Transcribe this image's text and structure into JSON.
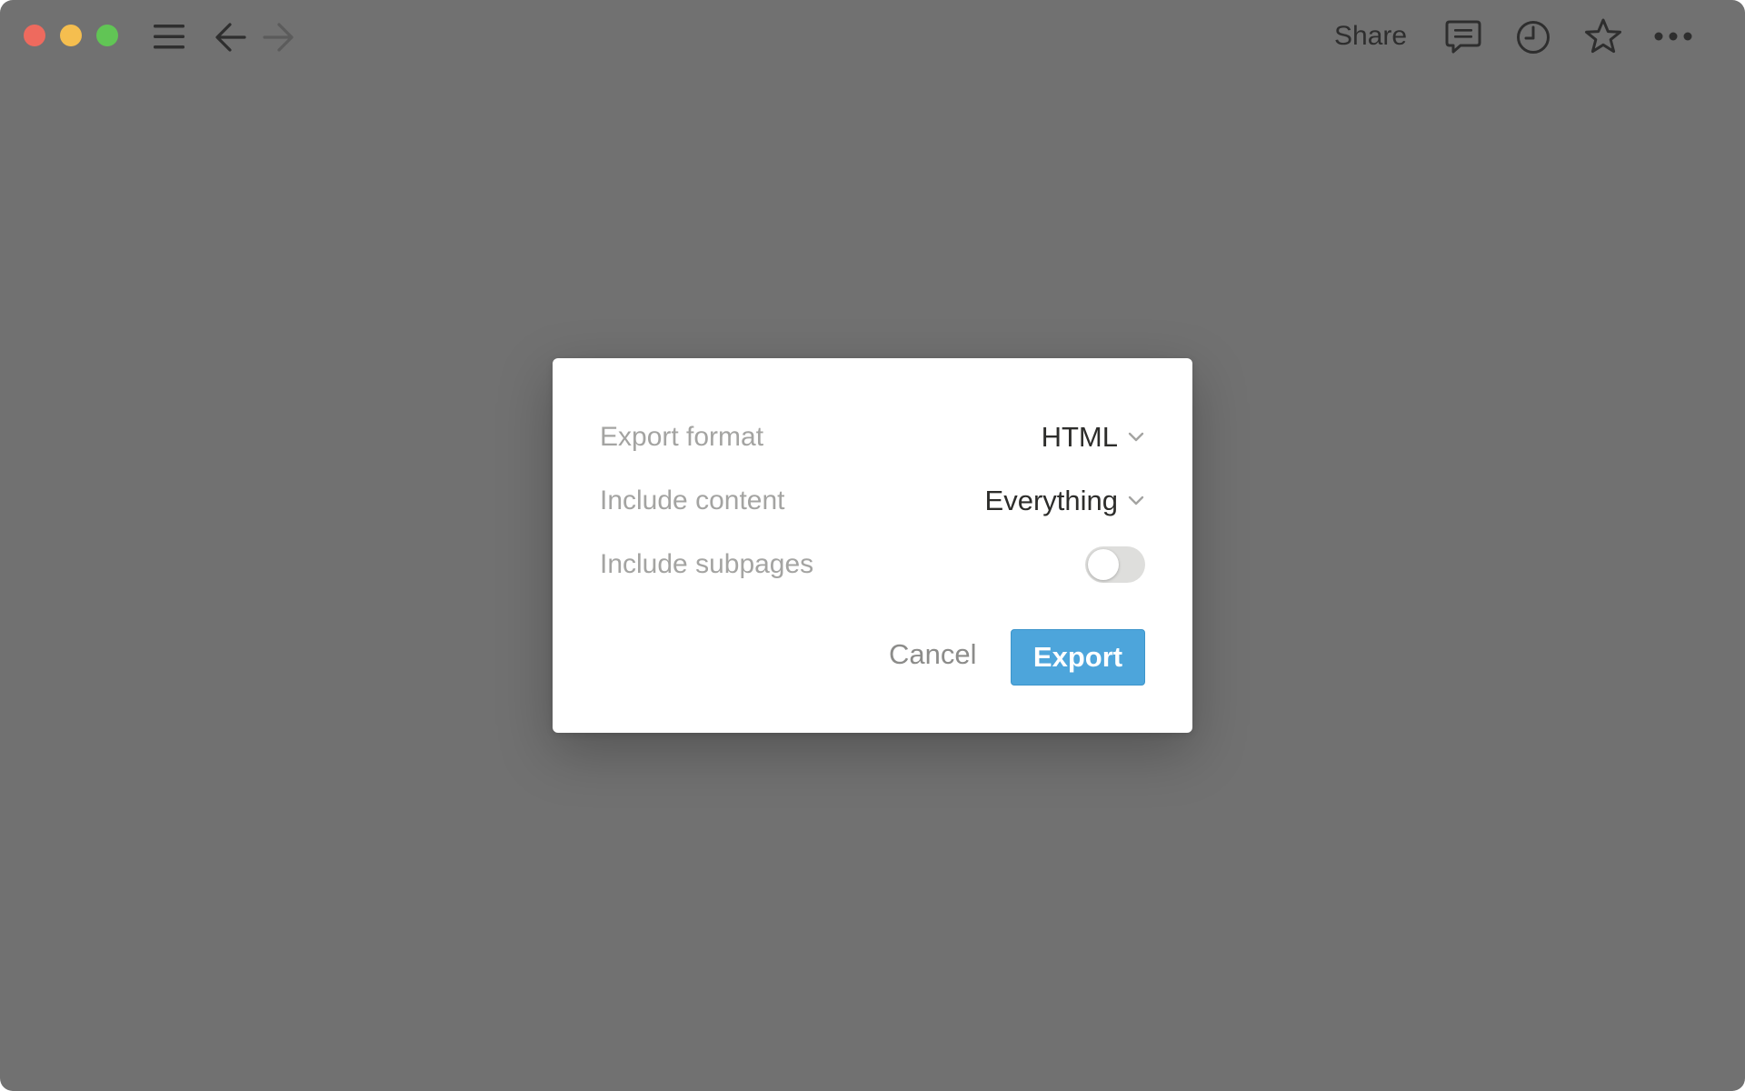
{
  "titlebar": {
    "traffic_lights": [
      "close",
      "minimize",
      "maximize"
    ],
    "icons": {
      "sidebar_toggle": "hamburger-icon",
      "back": "arrow-left-icon",
      "forward": "arrow-right-icon",
      "comments": "comment-icon",
      "history": "clock-icon",
      "favorite": "star-icon",
      "more": "ellipsis-icon"
    },
    "share_label": "Share"
  },
  "dialog": {
    "export_format": {
      "label": "Export format",
      "value": "HTML"
    },
    "include_content": {
      "label": "Include content",
      "value": "Everything"
    },
    "include_subpages": {
      "label": "Include subpages",
      "enabled": false
    },
    "cancel_label": "Cancel",
    "export_label": "Export"
  },
  "colors": {
    "backdrop": "#717171",
    "accent": "#4da5db",
    "close": "#ee6a5e",
    "minimize": "#f5be4f",
    "maximize": "#61c555"
  }
}
